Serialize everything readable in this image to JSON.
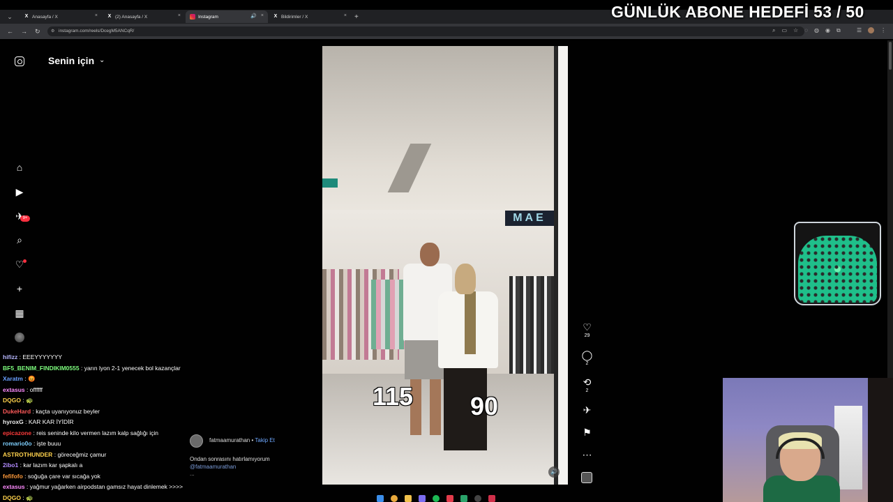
{
  "browser": {
    "tabs": [
      {
        "favicon": "X",
        "label": "Anasayfa / X",
        "active": false
      },
      {
        "favicon": "X",
        "label": "(2) Anasayfa / X",
        "active": false
      },
      {
        "favicon": "instagram-icon",
        "label": "Instagram",
        "active": true,
        "muted_icon": "speaker-icon"
      },
      {
        "favicon": "X",
        "label": "Bildirimler / X",
        "active": false
      }
    ],
    "close_glyph": "×",
    "new_tab_glyph": "+",
    "url": "instagram.com/reels/DcegM5ANCqR/"
  },
  "overlay": {
    "goal_label": "GÜNLÜK ABONE HEDEFİ 53 / 50",
    "goal_current": 53,
    "goal_target": 50
  },
  "instagram": {
    "feed_title": "Senin için",
    "notifications_badge": "9+",
    "reel": {
      "author": "fatmaamurathan",
      "follow_label": "Takip Et",
      "separator": "•",
      "caption": "Ondan sonrasını hatırlamıyorum",
      "mention": "@fatmaamurathan",
      "more": "...",
      "overlay_numbers": [
        "115",
        "90"
      ],
      "likes": "29",
      "comments": "2",
      "reposts": "2"
    }
  },
  "chat": [
    {
      "user": "hifizz",
      "text": "EEEYYYYYYY",
      "color": "#b8b8ff"
    },
    {
      "user": "BF5_BENIM_FINDIKIM0555",
      "text": "yarın lyon 2-1 yenecek bol kazançlar",
      "color": "#7fff7f"
    },
    {
      "user": "Xaratm",
      "text": "😡",
      "color": "#6aa0ff"
    },
    {
      "user": "extasus",
      "text": "offffff",
      "color": "#ff8cff"
    },
    {
      "user": "DQGO",
      "text": "🐢",
      "color": "#ffd24d"
    },
    {
      "user": "DukeHard",
      "text": "kaçta uyanıyonuz beyler",
      "color": "#ff5a5a"
    },
    {
      "user": "hyroxG",
      "text": "KAR KAR İYİDİR",
      "color": "#f0f0f0"
    },
    {
      "user": "epicazone",
      "text": "reis seninde kilo vermen lazım kalp sağlığı için",
      "color": "#ff3b3b"
    },
    {
      "user": "romario0o",
      "text": "işte buuu",
      "color": "#7fd0ff"
    },
    {
      "user": "ASTROTHUNDER",
      "text": "göreceğmiz çamur",
      "color": "#ffd24d"
    },
    {
      "user": "2ibo1",
      "text": "kar lazım kar şapkalı a",
      "color": "#b38cff"
    },
    {
      "user": "fefifofo",
      "text": "soğuğa çare var sıcağa yok",
      "color": "#ff9a3b"
    },
    {
      "user": "extasus",
      "text": "yağmur yağarken airpodstan gamsız hayat dinlemek >>>>",
      "color": "#ff8cff"
    },
    {
      "user": "DQGO",
      "text": "🐢",
      "color": "#ffd24d"
    }
  ],
  "chat_separator": ":"
}
